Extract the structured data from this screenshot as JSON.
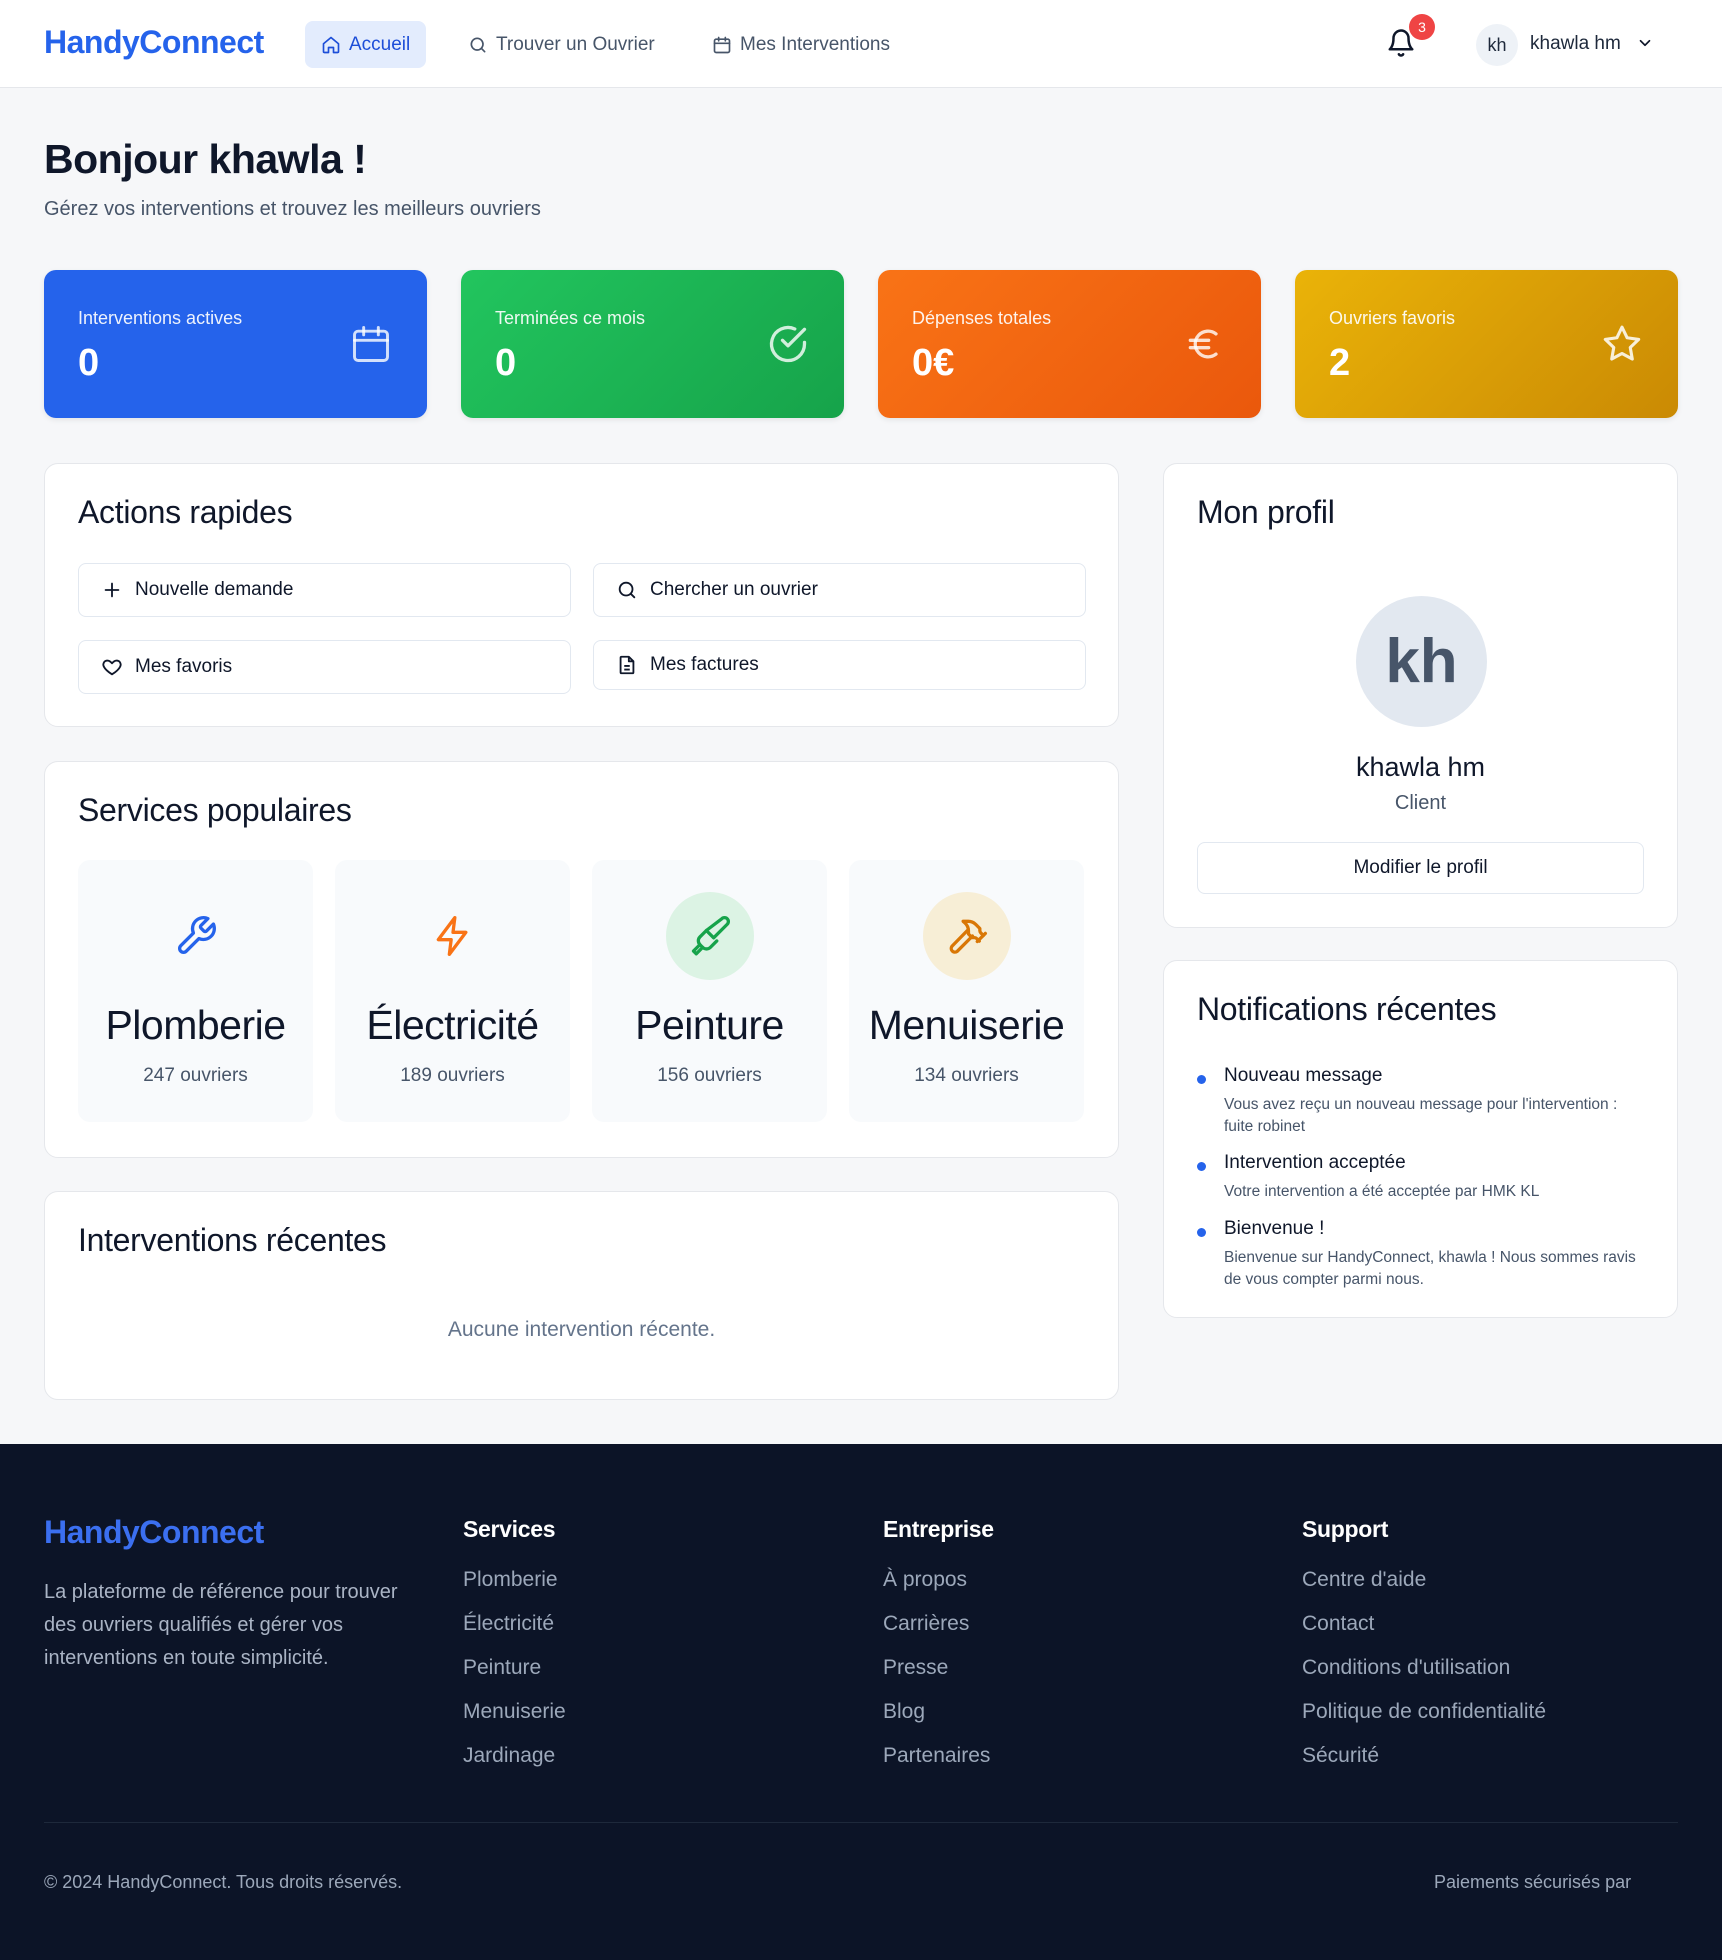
{
  "header": {
    "brand": "HandyConnect",
    "nav": [
      {
        "label": "Accueil",
        "icon": "home-icon",
        "active": true
      },
      {
        "label": "Trouver un Ouvrier",
        "icon": "search-icon",
        "active": false
      },
      {
        "label": "Mes Interventions",
        "icon": "calendar-icon",
        "active": false
      }
    ],
    "notification_count": "3",
    "user_initials": "kh",
    "user_name": "khawla hm"
  },
  "greeting": {
    "title": "Bonjour khawla !",
    "subtitle": "Gérez vos interventions et trouvez les meilleurs ouvriers"
  },
  "stats": [
    {
      "label": "Interventions actives",
      "value": "0",
      "icon": "calendar-icon",
      "color": "#2563eb"
    },
    {
      "label": "Terminées ce mois",
      "value": "0",
      "icon": "check-circle-icon",
      "color": "#16a34a"
    },
    {
      "label": "Dépenses totales",
      "value": "0€",
      "icon": "euro-icon",
      "color": "#ea580c"
    },
    {
      "label": "Ouvriers favoris",
      "value": "2",
      "icon": "star-icon",
      "color": "#ca8a04"
    }
  ],
  "quick_actions": {
    "title": "Actions rapides",
    "buttons": [
      {
        "label": "Nouvelle demande",
        "icon": "plus-icon"
      },
      {
        "label": "Chercher un ouvrier",
        "icon": "search-icon"
      },
      {
        "label": "Mes favoris",
        "icon": "heart-icon"
      },
      {
        "label": "Mes factures",
        "icon": "file-icon"
      }
    ]
  },
  "services": {
    "title": "Services populaires",
    "items": [
      {
        "name": "Plomberie",
        "count": "247 ouvriers",
        "icon": "wrench-icon",
        "color": "#2563eb"
      },
      {
        "name": "Électricité",
        "count": "189 ouvriers",
        "icon": "lightning-icon",
        "color": "#f97316"
      },
      {
        "name": "Peinture",
        "count": "156 ouvriers",
        "icon": "paintbrush-icon",
        "color": "#16a34a"
      },
      {
        "name": "Menuiserie",
        "count": "134 ouvriers",
        "icon": "hammer-icon",
        "color": "#d97706"
      }
    ]
  },
  "recent": {
    "title": "Interventions récentes",
    "empty": "Aucune intervention récente."
  },
  "profile": {
    "title": "Mon profil",
    "initials": "kh",
    "name": "khawla hm",
    "role": "Client",
    "edit_label": "Modifier le profil"
  },
  "notifications": {
    "title": "Notifications récentes",
    "items": [
      {
        "title": "Nouveau message",
        "body": "Vous avez reçu un nouveau message pour l'intervention : fuite robinet"
      },
      {
        "title": "Intervention acceptée",
        "body": "Votre intervention a été acceptée par HMK KL"
      },
      {
        "title": "Bienvenue !",
        "body": "Bienvenue sur HandyConnect, khawla ! Nous sommes ravis de vous compter parmi nous."
      }
    ]
  },
  "footer": {
    "brand": "HandyConnect",
    "description": "La plateforme de référence pour trouver des ouvriers qualifiés et gérer vos interventions en toute simplicité.",
    "columns": [
      {
        "title": "Services",
        "links": [
          "Plomberie",
          "Électricité",
          "Peinture",
          "Menuiserie",
          "Jardinage"
        ]
      },
      {
        "title": "Entreprise",
        "links": [
          "À propos",
          "Carrières",
          "Presse",
          "Blog",
          "Partenaires"
        ]
      },
      {
        "title": "Support",
        "links": [
          "Centre d'aide",
          "Contact",
          "Conditions d'utilisation",
          "Politique de confidentialité",
          "Sécurité"
        ]
      }
    ],
    "copyright": "© 2024 HandyConnect. Tous droits réservés.",
    "payments": "Paiements sécurisés par"
  }
}
